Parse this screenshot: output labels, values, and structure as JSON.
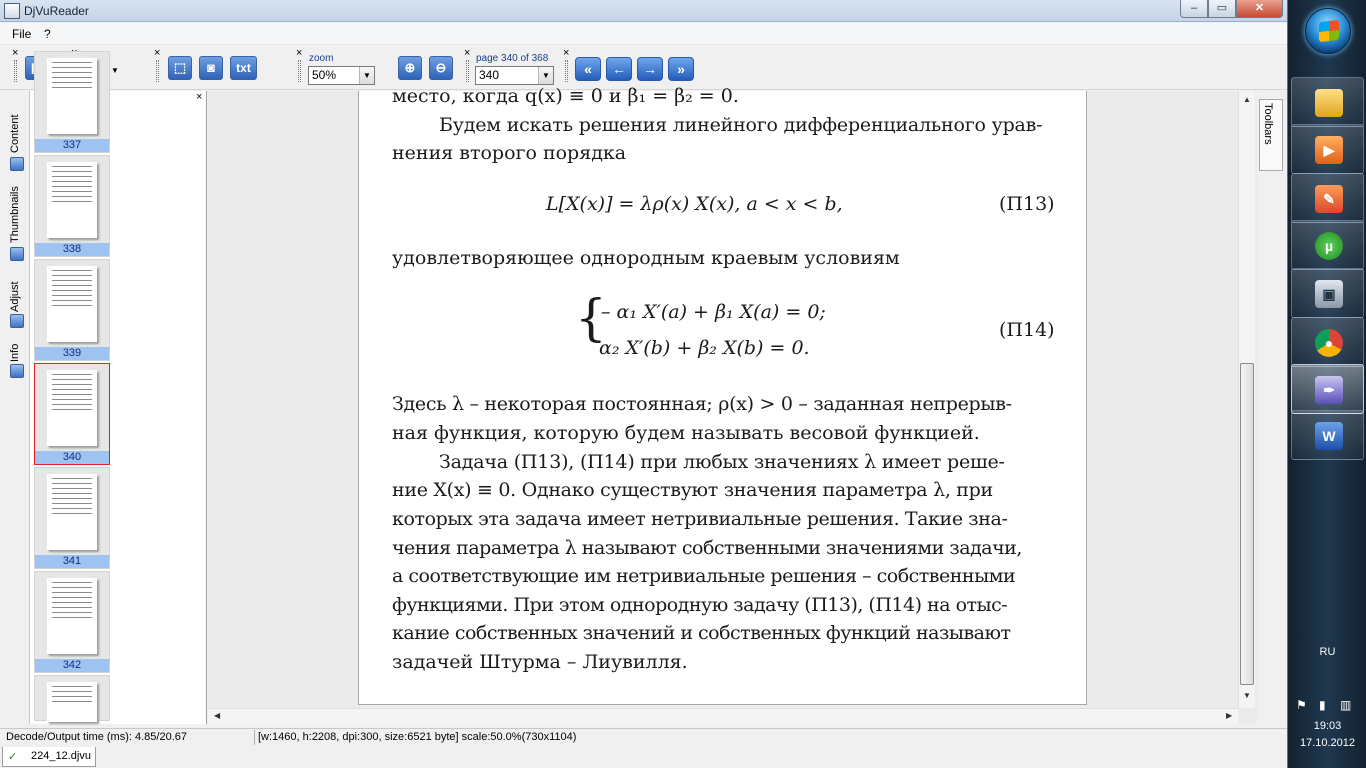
{
  "window": {
    "title": "DjVuReader",
    "min_label": "–",
    "max_label": "▭",
    "close_label": "✕"
  },
  "menu": {
    "items": [
      "File",
      "?"
    ]
  },
  "toolbar": {
    "close_glyph": "×",
    "zoom_label": "zoom",
    "zoom_value": "50%",
    "page_label": "page 340 of 368",
    "page_value": "340",
    "txt_label": "txt",
    "zoom_in_glyph": "⊕",
    "zoom_out_glyph": "⊖",
    "nav": {
      "first": "«",
      "prev": "←",
      "next": "→",
      "last": "»"
    }
  },
  "side_tabs": {
    "content": "Content",
    "thumbnails": "Thumbnails",
    "adjust": "Adjust",
    "info": "Info"
  },
  "thumbnails": {
    "close_glyph": "×",
    "items": [
      "337",
      "338",
      "339",
      "340",
      "341",
      "342"
    ],
    "selected": "340"
  },
  "document": {
    "lines": [
      "место, когда q(x) ≡ 0 и β₁ = β₂ = 0.",
      "Будем искать решения линейного дифференциального урав-",
      "нения второго порядка",
      "L[X(x)] = λρ(x) X(x),    a < x < b,",
      "удовлетворяющее однородным краевым условиям",
      "– α₁ X′(a) + β₁ X(a) = 0;",
      "α₂ X′(b) + β₂ X(b) = 0.",
      "Здесь λ – некоторая постоянная; ρ(x) > 0 – заданная непрерыв-",
      "ная функция, которую будем называть весовой функцией.",
      "Задача (П13), (П14) при любых значениях λ имеет реше-",
      "ние X(x) ≡ 0. Однако существуют значения параметра λ, при",
      "которых эта задача имеет нетривиальные решения. Такие зна-",
      "чения параметра λ называют собственными значениями задачи,",
      "а соответствующие им нетривиальные решения – собственными",
      "функциями. При этом однородную задачу (П13), (П14) на отыс-",
      "кание собственных значений и собственных функций называют",
      "задачей Штурма – Лиувилля."
    ],
    "eq_labels": [
      "(П13)",
      "(П14)"
    ]
  },
  "toolbars_tab": "Toolbars",
  "status": {
    "decode": "Decode/Output time (ms): 4.85/20.67",
    "info": "[w:1460, h:2208, dpi:300, size:6521 byte] scale:50.0%(730x1104)"
  },
  "doc_tab": {
    "name": "224_12.djvu",
    "icon": "✓"
  },
  "taskbar": {
    "lang": "RU",
    "time": "19:03",
    "date": "17.10.2012",
    "apps": [
      "explorer",
      "media-player",
      "paint",
      "utorrent",
      "computer",
      "chrome",
      "djvu-reader",
      "word"
    ]
  }
}
